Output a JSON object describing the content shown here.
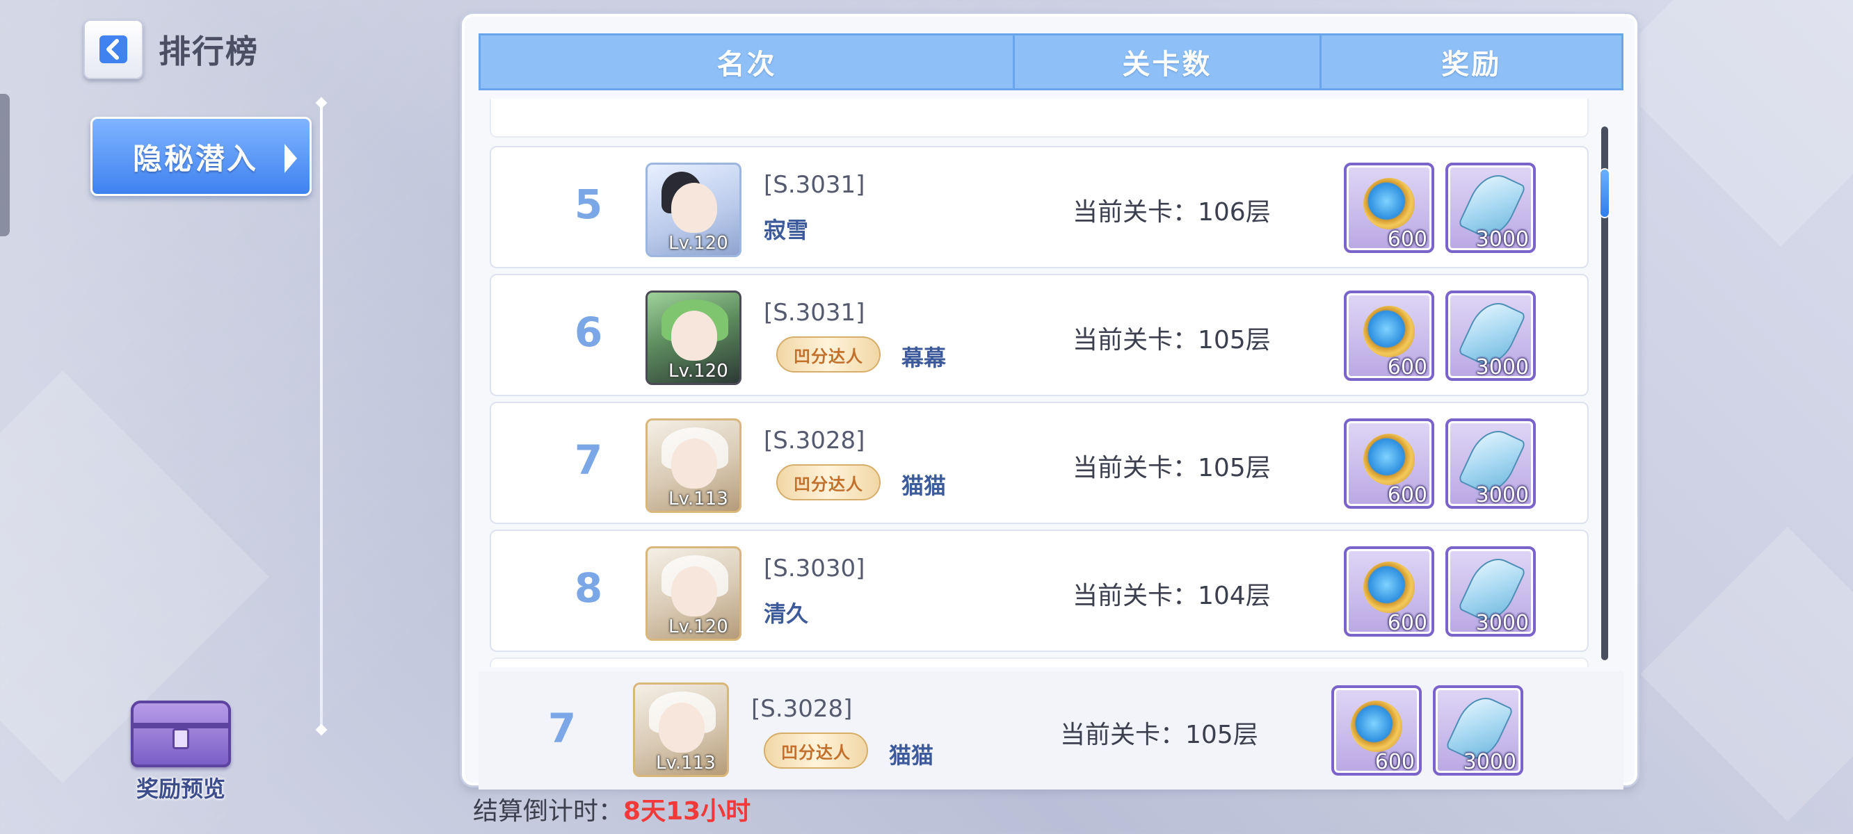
{
  "header": {
    "title": "排行榜"
  },
  "sidebar": {
    "mode_button": "隐秘潜入",
    "reward_preview": "奖励预览"
  },
  "table": {
    "columns": [
      "名次",
      "关卡数",
      "奖励"
    ]
  },
  "rows": [
    {
      "rank": "5",
      "server": "[S.3031]",
      "name": "寂雪",
      "title_badge": "",
      "level": "Lv.120",
      "stage": "当前关卡：106层",
      "rewards": [
        {
          "icon": "compass-coin-icon",
          "count": "600"
        },
        {
          "icon": "crystal-leaf-icon",
          "count": "3000"
        }
      ]
    },
    {
      "rank": "6",
      "server": "[S.3031]",
      "name": "幕幕",
      "title_badge": "凹分达人",
      "level": "Lv.120",
      "stage": "当前关卡：105层",
      "rewards": [
        {
          "icon": "compass-coin-icon",
          "count": "600"
        },
        {
          "icon": "crystal-leaf-icon",
          "count": "3000"
        }
      ]
    },
    {
      "rank": "7",
      "server": "[S.3028]",
      "name": "猫猫",
      "title_badge": "凹分达人",
      "level": "Lv.113",
      "stage": "当前关卡：105层",
      "rewards": [
        {
          "icon": "compass-coin-icon",
          "count": "600"
        },
        {
          "icon": "crystal-leaf-icon",
          "count": "3000"
        }
      ]
    },
    {
      "rank": "8",
      "server": "[S.3030]",
      "name": "清久",
      "title_badge": "",
      "level": "Lv.120",
      "stage": "当前关卡：104层",
      "rewards": [
        {
          "icon": "compass-coin-icon",
          "count": "600"
        },
        {
          "icon": "crystal-leaf-icon",
          "count": "3000"
        }
      ]
    }
  ],
  "my_rank": {
    "rank": "7",
    "server": "[S.3028]",
    "name": "猫猫",
    "title_badge": "凹分达人",
    "level": "Lv.113",
    "stage": "当前关卡：105层",
    "rewards": [
      {
        "icon": "compass-coin-icon",
        "count": "600"
      },
      {
        "icon": "crystal-leaf-icon",
        "count": "3000"
      }
    ]
  },
  "footer": {
    "countdown_label": "结算倒计时：",
    "countdown_value": "8天13小时"
  },
  "colors": {
    "header_blue": "#8ec0f7",
    "rank_number": "#7ba7e6",
    "countdown_red": "#f03a3a",
    "name_blue": "#3d5a9a"
  }
}
